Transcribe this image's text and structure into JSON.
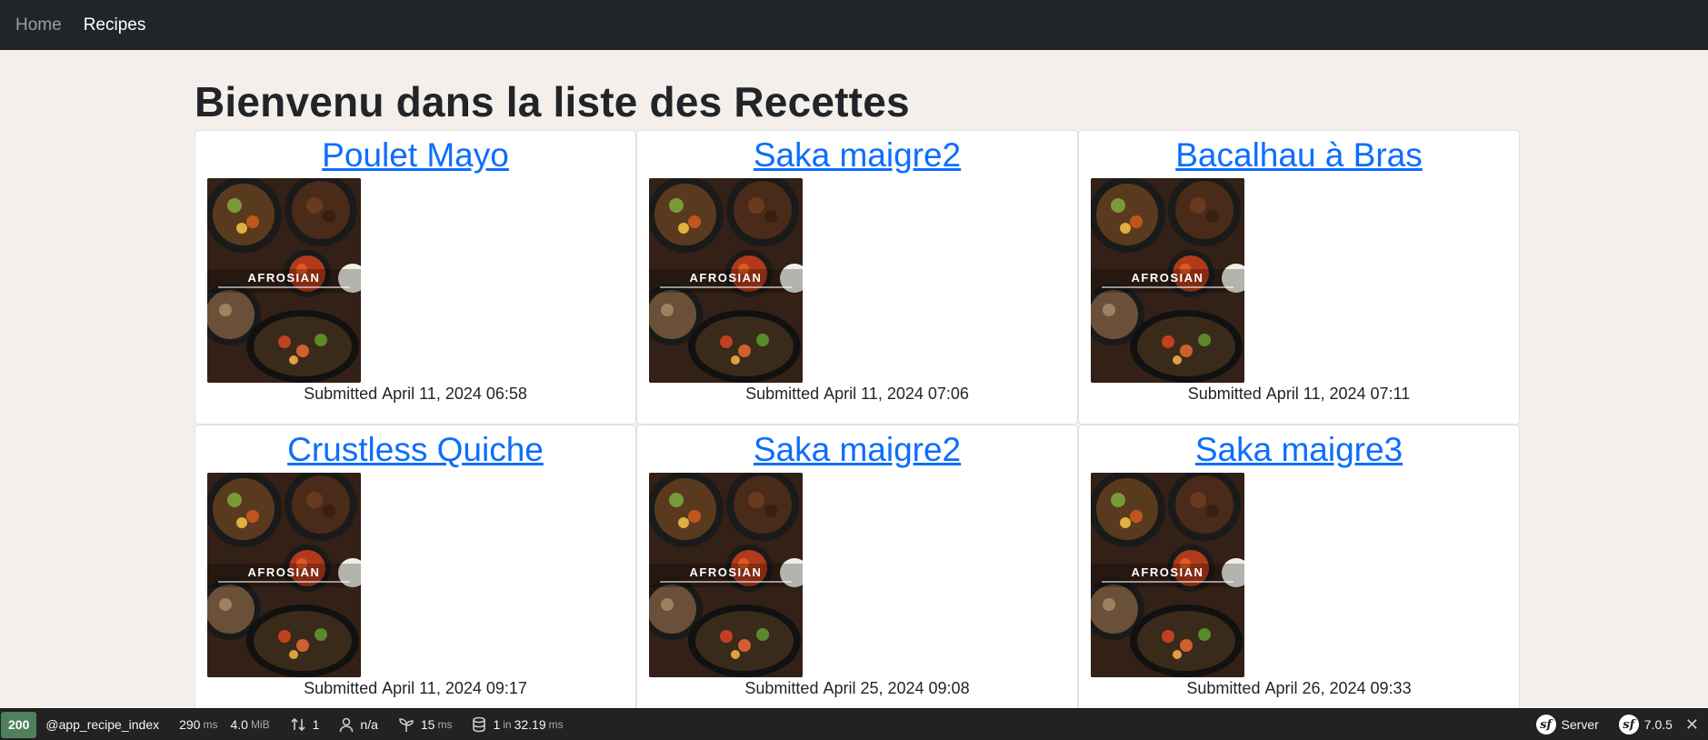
{
  "nav": {
    "items": [
      {
        "label": "Home",
        "active": false
      },
      {
        "label": "Recipes",
        "active": true
      }
    ]
  },
  "page": {
    "title": "Bienvenu dans la liste des Recettes"
  },
  "recipes": [
    {
      "title": "Poulet Mayo",
      "image_text": "AFROSIAN",
      "submitted_label": "Submitted",
      "date": "April 11, 2024 06:58"
    },
    {
      "title": "Saka maigre2",
      "image_text": "AFROSIAN",
      "submitted_label": "Submitted",
      "date": "April 11, 2024 07:06"
    },
    {
      "title": "Bacalhau à Bras",
      "image_text": "AFROSIAN",
      "submitted_label": "Submitted",
      "date": "April 11, 2024 07:11"
    },
    {
      "title": "Crustless Quiche",
      "image_text": "AFROSIAN",
      "submitted_label": "Submitted",
      "date": "April 11, 2024 09:17"
    },
    {
      "title": "Saka maigre2",
      "image_text": "AFROSIAN",
      "submitted_label": "Submitted",
      "date": "April 25, 2024 09:08"
    },
    {
      "title": "Saka maigre3",
      "image_text": "AFROSIAN",
      "submitted_label": "Submitted",
      "date": "April 26, 2024 09:33"
    }
  ],
  "toolbar": {
    "status": "200",
    "route": "@app_recipe_index",
    "time_value": "290",
    "time_unit": "ms",
    "memory_value": "4.0",
    "memory_unit": "MiB",
    "requests": "1",
    "user": "n/a",
    "twig_value": "15",
    "twig_unit": "ms",
    "db_queries": "1",
    "db_in": "in",
    "db_time": "32.19",
    "db_unit": "ms",
    "server_label": "Server",
    "version": "7.0.5",
    "colors": {
      "status_bg": "#4f805d",
      "bar_bg": "#222222"
    }
  }
}
